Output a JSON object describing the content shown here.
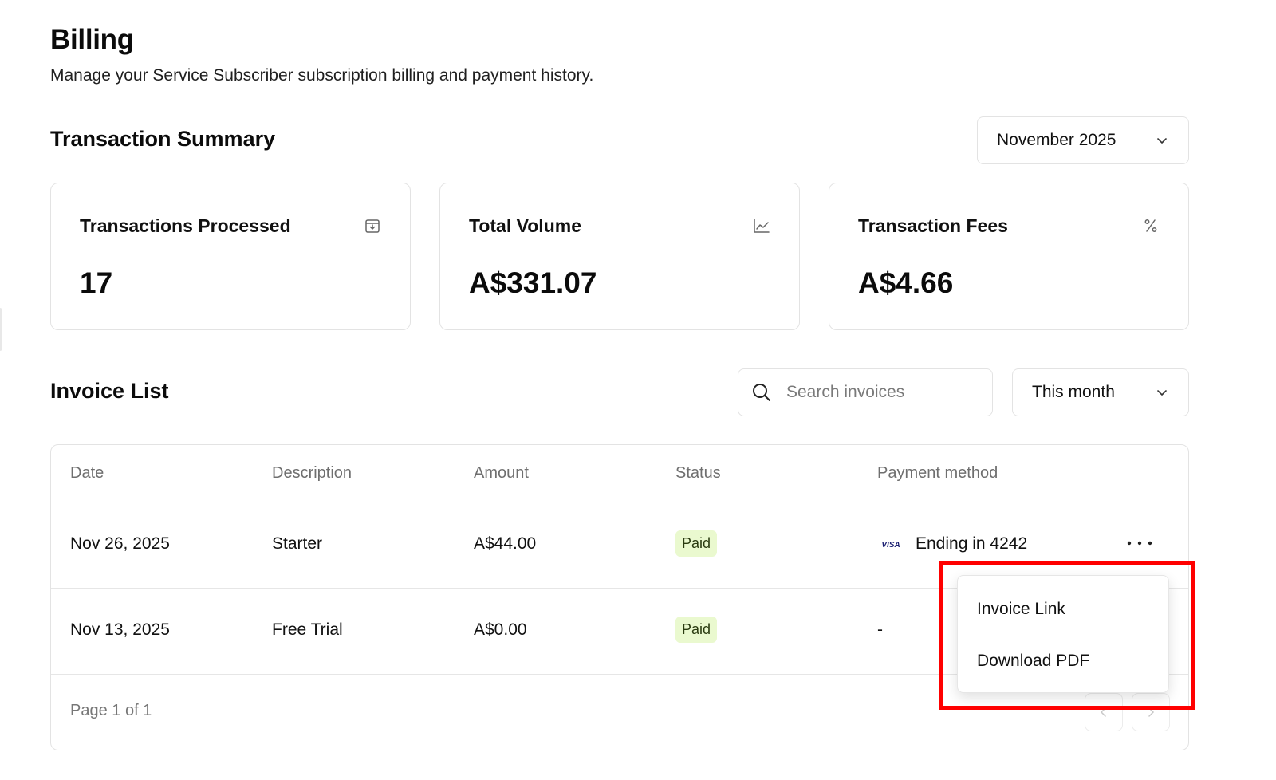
{
  "header": {
    "title": "Billing",
    "subtitle": "Manage your Service Subscriber subscription billing and payment history."
  },
  "summary": {
    "title": "Transaction Summary",
    "month_select": "November 2025",
    "cards": [
      {
        "label": "Transactions Processed",
        "value": "17",
        "icon": "archive-download-icon"
      },
      {
        "label": "Total Volume",
        "value": "A$331.07",
        "icon": "line-chart-icon"
      },
      {
        "label": "Transaction Fees",
        "value": "A$4.66",
        "icon": "percent-icon"
      }
    ]
  },
  "invoices": {
    "title": "Invoice List",
    "search_placeholder": "Search invoices",
    "range_select": "This month",
    "columns": [
      "Date",
      "Description",
      "Amount",
      "Status",
      "Payment method"
    ],
    "rows": [
      {
        "date": "Nov 26, 2025",
        "description": "Starter",
        "amount": "A$44.00",
        "status": "Paid",
        "payment": "Ending in 4242",
        "card_brand": "VISA"
      },
      {
        "date": "Nov 13, 2025",
        "description": "Free Trial",
        "amount": "A$0.00",
        "status": "Paid",
        "payment": "-"
      }
    ],
    "pagination": "Page 1 of 1"
  },
  "menu": {
    "items": [
      "Invoice Link",
      "Download PDF"
    ]
  },
  "colors": {
    "badge_bg": "#eaf9cf",
    "highlight": "#ff0000",
    "border": "#e3e3e3"
  }
}
